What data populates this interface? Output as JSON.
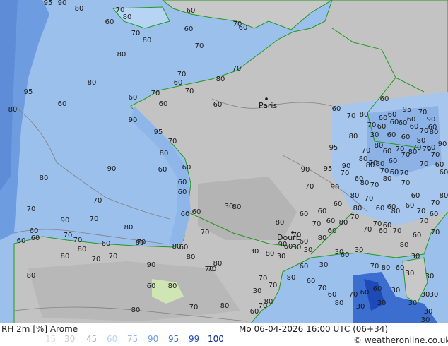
{
  "footer": {
    "product": "RH 2m [%] Arome",
    "valid_time": "Mo 06-04-2026 16:00 UTC (06+34)",
    "credit": "© weatheronline.co.uk"
  },
  "scale": [
    {
      "label": "15",
      "color": "#dcdcdc"
    },
    {
      "label": "30",
      "color": "#c8c8c8"
    },
    {
      "label": "45",
      "color": "#b4b4b4"
    },
    {
      "label": "60",
      "color": "#b6d4f4"
    },
    {
      "label": "75",
      "color": "#96bcec"
    },
    {
      "label": "90",
      "color": "#6e9ce0"
    },
    {
      "label": "95",
      "color": "#3c6ed0"
    },
    {
      "label": "99",
      "color": "#1e4ab8"
    },
    {
      "label": "100",
      "color": "#0a2a90"
    }
  ],
  "cities": [
    {
      "name": "Paris"
    },
    {
      "name": "Dourb"
    }
  ],
  "contours": [
    "95",
    "90",
    "80",
    "70",
    "80",
    "60",
    "70",
    "80",
    "70",
    "60",
    "60",
    "70",
    "60",
    "80",
    "70",
    "70",
    "60",
    "80",
    "70",
    "60",
    "60",
    "70",
    "60",
    "80",
    "60",
    "95",
    "80",
    "90",
    "95",
    "70",
    "80",
    "60",
    "60",
    "60",
    "60",
    "60",
    "60",
    "80",
    "70",
    "80",
    "70",
    "60",
    "90",
    "80",
    "70",
    "70",
    "60",
    "90",
    "70",
    "80",
    "80",
    "70",
    "60",
    "60",
    "70",
    "60",
    "80",
    "80",
    "70",
    "70",
    "80",
    "90",
    "80",
    "80",
    "70",
    "30",
    "80",
    "30",
    "30",
    "70",
    "60",
    "80",
    "80",
    "80",
    "70",
    "60",
    "70",
    "80",
    "30",
    "70",
    "70",
    "90",
    "60",
    "30",
    "30",
    "30",
    "30",
    "60",
    "30",
    "30",
    "30",
    "30",
    "30",
    "30",
    "60",
    "30",
    "30",
    "30",
    "30",
    "30",
    "30",
    "60",
    "60",
    "70",
    "80",
    "60",
    "60",
    "95",
    "70",
    "90",
    "80",
    "30",
    "70",
    "60",
    "60",
    "80",
    "80",
    "90",
    "95",
    "90",
    "80",
    "90",
    "80",
    "80",
    "70",
    "60",
    "70",
    "60",
    "70",
    "60",
    "80",
    "60",
    "70",
    "60",
    "70",
    "80",
    "95",
    "70",
    "80",
    "70",
    "70",
    "60",
    "60",
    "70",
    "60",
    "80",
    "70",
    "90",
    "80",
    "80",
    "80",
    "60",
    "70",
    "70",
    "70",
    "70",
    "60",
    "70",
    "60",
    "60",
    "70",
    "60",
    "80",
    "60",
    "70",
    "60",
    "70",
    "60",
    "70",
    "80",
    "60",
    "70",
    "60",
    "60",
    "60",
    "70",
    "60",
    "60",
    "60",
    "80",
    "70",
    "60",
    "70",
    "80",
    "60",
    "70",
    "60",
    "70",
    "60",
    "80",
    "70",
    "60",
    "80",
    "60",
    "70",
    "60",
    "80",
    "70",
    "60",
    "60",
    "70",
    "80",
    "60",
    "60",
    "90",
    "80",
    "60",
    "70",
    "60",
    "70",
    "80",
    "80",
    "80",
    "60"
  ]
}
